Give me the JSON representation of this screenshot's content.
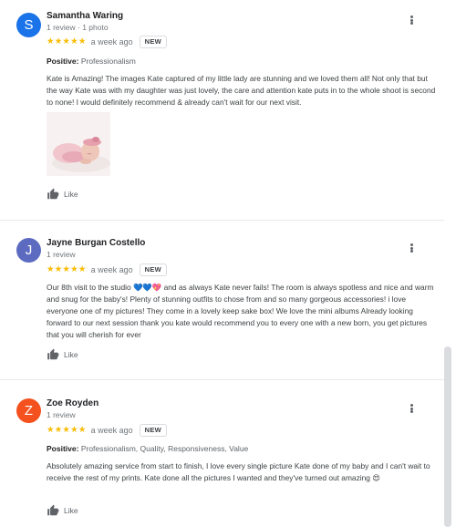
{
  "reviews": [
    {
      "avatar_letter": "S",
      "avatar_color": "#1a73e8",
      "name": "Samantha Waring",
      "meta": "1 review · 1 photo",
      "stars": "★★★★★",
      "date": "a week ago",
      "badge": "NEW",
      "positive_label": "Positive:",
      "positive_values": "Professionalism",
      "text": "Kate is Amazing! The images Kate captured of my little lady are stunning and we loved them all! Not only that but the way Kate was with my daughter was just lovely, the care and attention kate puts in to the whole shoot is second to none! I would definitely recommend & already can't wait for our next visit.",
      "like_label": "Like"
    },
    {
      "avatar_letter": "J",
      "avatar_color": "#5c6bc0",
      "name": "Jayne Burgan Costello",
      "meta": "1 review",
      "stars": "★★★★★",
      "date": "a week ago",
      "badge": "NEW",
      "text": "Our 8th visit to the studio 💙💙💖 and as always Kate never fails! The room is always spotless and nice and warm and snug for the baby's! Plenty of stunning  outfits to chose from and so many  gorgeous accessories! i love everyone one of my pictures! They come in a lovely keep sake box! We love the mini albums    Already looking forward to our next session    thank you kate would recommend you to every one with a new born, you get pictures  that you will cherish for ever",
      "like_label": "Like"
    },
    {
      "avatar_letter": "Z",
      "avatar_color": "#f4511e",
      "name": "Zoe Royden",
      "meta": "1 review",
      "stars": "★★★★★",
      "date": "a week ago",
      "badge": "NEW",
      "positive_label": "Positive:",
      "positive_values": "Professionalism, Quality, Responsiveness, Value",
      "text": "Absolutely amazing service from start to finish, I love every single picture Kate done of my baby and I can't wait to receive the rest of my prints. Kate done all the pictures I wanted and they've turned out amazing 😍",
      "like_label": "Like"
    }
  ]
}
